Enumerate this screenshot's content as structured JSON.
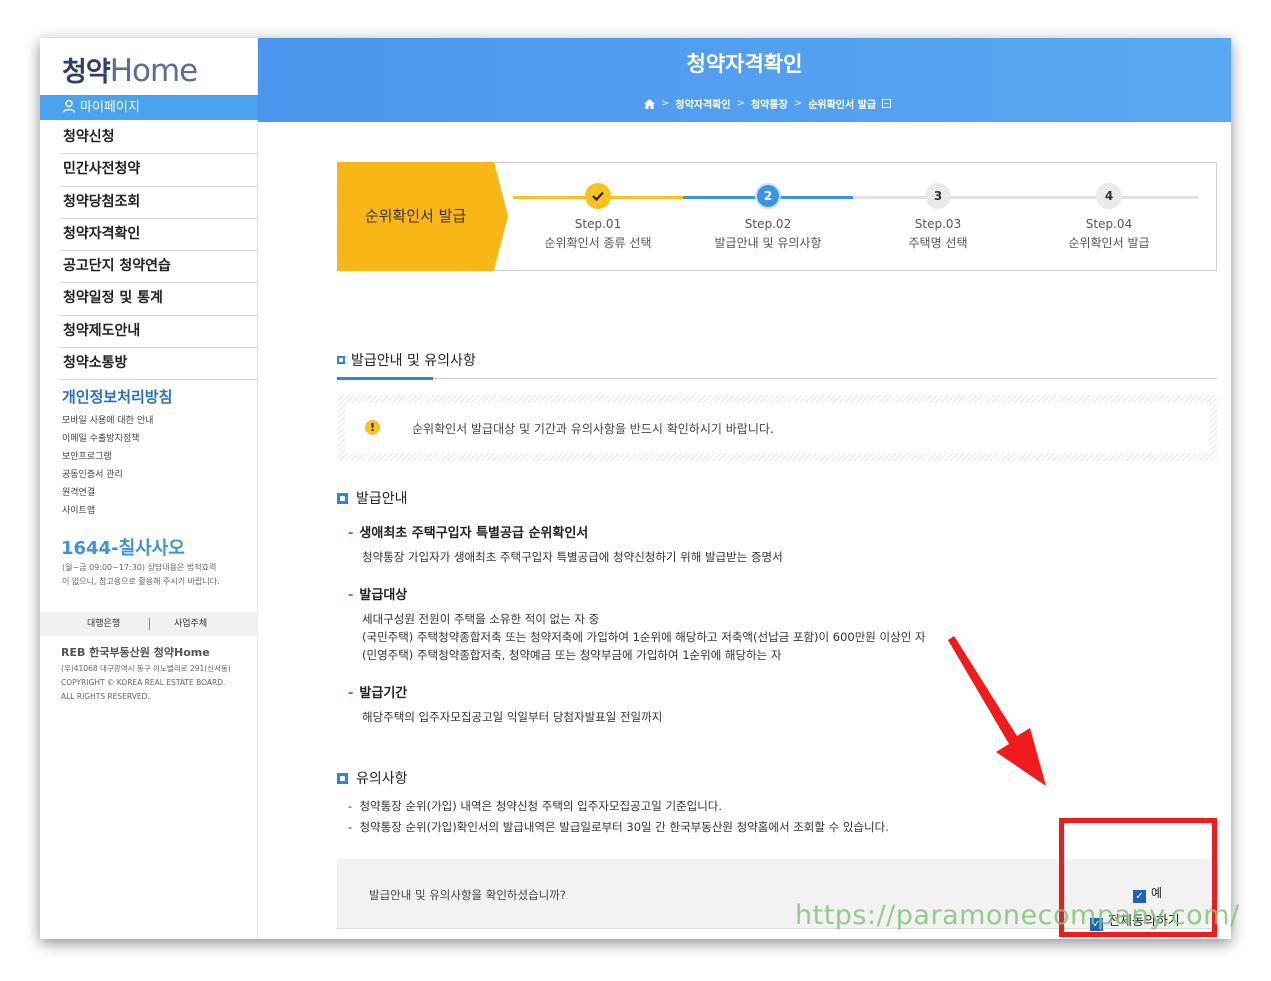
{
  "sidebar": {
    "logo_hangul": "청약",
    "logo_home": "Home",
    "mypage": "마이페이지",
    "menu": [
      "청약신청",
      "민간사전청약",
      "청약당첨조회",
      "청약자격확인",
      "공고단지 청약연습",
      "청약일정 및 통계",
      "청약제도안내",
      "청약소통방"
    ],
    "privacy": "개인정보처리방침",
    "sublinks": [
      "모바일 사용에 대한 안내",
      "이메일 수출방지정책",
      "보안프로그램",
      "공동인증서 관리",
      "원격연결",
      "사이트맵"
    ],
    "phone": "1644-칠사사오",
    "phone_desc": "(월~금 09:00~17:30) 상담내용은 법적효력이 없으니, 참고용으로 활용해 주시기 바랍니다.",
    "bank_left": "대행은행",
    "bank_right": "사업주체",
    "reb": "REB 한국부동산원 청약Home",
    "address": "(우)41068 대구광역시 동구 이노밸리로 291(신서동)",
    "copyright_1": "COPYRIGHT © KOREA REAL ESTATE BOARD.",
    "copyright_2": "ALL RIGHTS RESERVED."
  },
  "header": {
    "title": "청약자격확인",
    "breadcrumb": [
      "청약자격확인",
      "청약통장",
      "순위확인서 발급"
    ]
  },
  "steps": {
    "label": "순위확인서 발급",
    "items": [
      {
        "num": "Step.01",
        "name": "순위확인서 종류 선택",
        "state": "done"
      },
      {
        "num": "Step.02",
        "name": "발급안내 및 유의사항",
        "state": "active",
        "marker": "2"
      },
      {
        "num": "Step.03",
        "name": "주택명 선택",
        "state": "todo",
        "marker": "3"
      },
      {
        "num": "Step.04",
        "name": "순위확인서 발급",
        "state": "todo",
        "marker": "4"
      }
    ]
  },
  "section_title": "발급안내 및 유의사항",
  "notice": "순위확인서 발급대상 및 기간과 유의사항을 반드시 확인하시기 바랍니다.",
  "guide": {
    "heading": "발급안내",
    "item1_title": "생애최초 주택구입자 특별공급 순위확인서",
    "item1_text": "청약통장 가입자가 생애최초 주택구입자 특별공급에 청약신청하기 위해 발급받는 증명서",
    "item2_title": "발급대상",
    "item2_lines": [
      "세대구성원 전원이 주택을 소유한 적이 없는 자 중",
      "(국민주택) 주택청약종합저축 또는 청약저축에 가입하여 1순위에 해당하고 저축액(선납금 포함)이 600만원 이상인 자",
      "(민영주택) 주택청약종합저축, 청약예금 또는 청약부금에 가입하여 1순위에 해당하는 자"
    ],
    "item3_title": "발급기간",
    "item3_text": "해당주택의 입주자모집공고일 익일부터 당첨자발표일 전일까지"
  },
  "caution": {
    "heading": "유의사항",
    "lines": [
      "청약통장 순위(가입) 내역은 청약신청 주택의 입주자모집공고일 기준입니다.",
      "청약통장 순위(가입)확인서의 발급내역은 발급일로부터 30일 간 한국부동산원 청약홈에서 조회할 수 있습니다."
    ]
  },
  "confirm": {
    "question": "발급안내 및 유의사항을 확인하셨습니까?",
    "yes_label": "예",
    "all_agree": "전체동의하기"
  },
  "watermark": "https://paramonecompany.com/",
  "colors": {
    "header_blue": "#4c95ee",
    "step_yellow": "#f8b617",
    "accent_blue": "#2d86e0",
    "highlight_red": "#f21b1b"
  }
}
